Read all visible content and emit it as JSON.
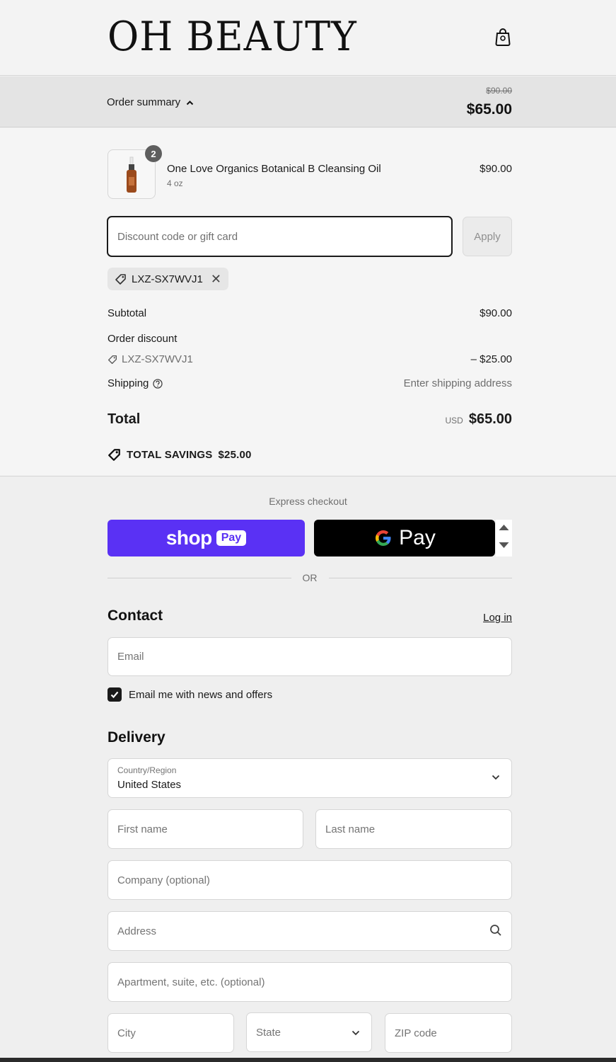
{
  "header": {
    "logo": "OH BEAUTY",
    "cart_icon": "shopping-bag-icon"
  },
  "summary_bar": {
    "toggle_label": "Order summary",
    "original_total": "$90.00",
    "total": "$65.00"
  },
  "item": {
    "quantity": "2",
    "name": "One Love Organics Botanical B Cleansing Oil",
    "variant": "4 oz",
    "price": "$90.00"
  },
  "discount": {
    "placeholder": "Discount code or gift card",
    "apply_label": "Apply",
    "applied_code": "LXZ-SX7WVJ1"
  },
  "totals": {
    "subtotal_label": "Subtotal",
    "subtotal": "$90.00",
    "order_discount_label": "Order discount",
    "discount_code": "LXZ-SX7WVJ1",
    "discount_amount": "– $25.00",
    "shipping_label": "Shipping",
    "shipping_value": "Enter shipping address",
    "total_label": "Total",
    "currency": "USD",
    "total": "$65.00",
    "savings_label": "TOTAL SAVINGS",
    "savings": "$25.00"
  },
  "express": {
    "title": "Express checkout",
    "shop_word": "shop",
    "shop_pay": "Pay",
    "gpay_word": "Pay",
    "or": "OR"
  },
  "contact": {
    "title": "Contact",
    "login": "Log in",
    "email_placeholder": "Email",
    "news_label": "Email me with news and offers",
    "news_checked": true
  },
  "delivery": {
    "title": "Delivery",
    "country_label": "Country/Region",
    "country_value": "United States",
    "first_name": "First name",
    "last_name": "Last name",
    "company": "Company (optional)",
    "address": "Address",
    "apartment": "Apartment, suite, etc. (optional)",
    "city": "City",
    "state": "State",
    "zip": "ZIP code"
  },
  "colors": {
    "shop_pay": "#5a31f4",
    "gpay": "#000000",
    "text": "#1a1a1a"
  }
}
